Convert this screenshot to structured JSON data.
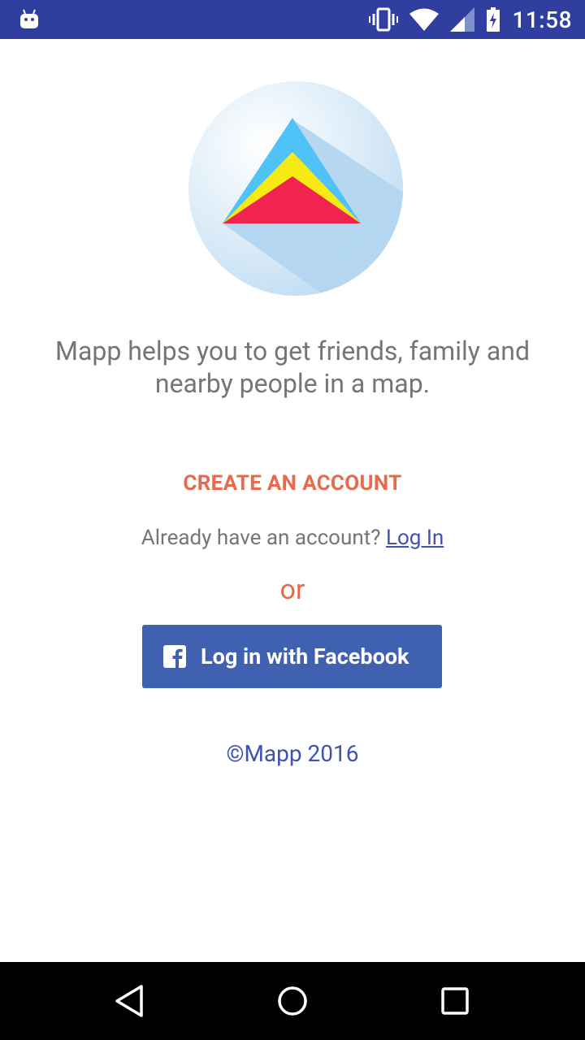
{
  "status_bar": {
    "time": "11:58",
    "icons": [
      "android-icon",
      "vibrate-icon",
      "wifi-icon",
      "cell-signal-icon",
      "battery-charging-icon"
    ]
  },
  "logo": {
    "colors": {
      "circle": "#b3d6f0",
      "blue": "#4fc3f7",
      "yellow": "#f5ea14",
      "red": "#f0244e"
    }
  },
  "tagline": "Mapp helps you to get friends, family and nearby people in a map.",
  "create_account_label": "CREATE AN ACCOUNT",
  "already_account_text": "Already have an account?",
  "login_link_label": "Log In",
  "or_text": "or",
  "facebook_button_label": "Log in with Facebook",
  "copyright": "©Mapp 2016",
  "colors": {
    "status_bar": "#303f9f",
    "accent_orange": "#e86a4e",
    "link_blue": "#3f51b5",
    "facebook_blue": "#4060b0",
    "text_gray": "#757575"
  },
  "nav_bar": {
    "buttons": [
      "back-icon",
      "home-icon",
      "recent-apps-icon"
    ]
  }
}
